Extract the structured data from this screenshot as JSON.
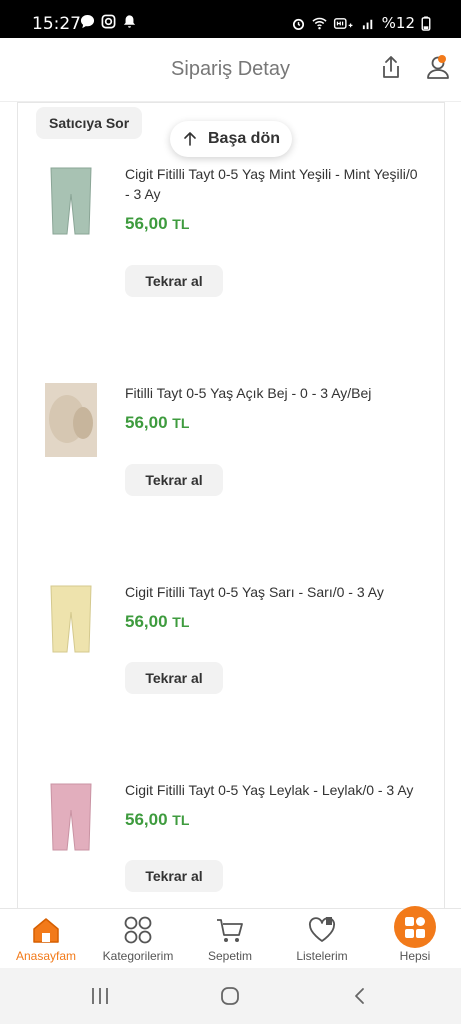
{
  "status_bar": {
    "time": "15:27",
    "battery": "%12"
  },
  "header": {
    "title": "Sipariş Detay"
  },
  "seller": {
    "ask_label": "Satıcıya Sor"
  },
  "back_to_top": {
    "label": "Başa dön"
  },
  "items": [
    {
      "name": "Cigit Fitilli Tayt 0-5 Yaş Mint Yeşili - Mint Yeşili/0 - 3 Ay",
      "price": "56,00",
      "currency": "TL",
      "reorder_label": "Tekrar al",
      "color": "#a8c2b3"
    },
    {
      "name": "Fitilli Tayt 0-5 Yaş Açık Bej - 0 - 3 Ay/Bej",
      "price": "56,00",
      "currency": "TL",
      "reorder_label": "Tekrar al",
      "color": "#e2d6c6"
    },
    {
      "name": "Cigit Fitilli Tayt 0-5 Yaş Sarı - Sarı/0 - 3 Ay",
      "price": "56,00",
      "currency": "TL",
      "reorder_label": "Tekrar al",
      "color": "#eee3ad"
    },
    {
      "name": "Cigit Fitilli Tayt 0-5 Yaş Leylak - Leylak/0 - 3 Ay",
      "price": "56,00",
      "currency": "TL",
      "reorder_label": "Tekrar al",
      "color": "#e2aebd"
    }
  ],
  "bottom_nav": [
    {
      "label": "Anasayfam",
      "icon": "home-icon",
      "active": true
    },
    {
      "label": "Kategorilerim",
      "icon": "categories-icon",
      "active": false
    },
    {
      "label": "Sepetim",
      "icon": "cart-icon",
      "active": false
    },
    {
      "label": "Listelerim",
      "icon": "heart-list-icon",
      "active": false
    },
    {
      "label": "Hepsi",
      "icon": "all-apps-icon",
      "active": false
    }
  ],
  "colors": {
    "accent": "#f27a1a",
    "price": "#3e9b3e"
  }
}
